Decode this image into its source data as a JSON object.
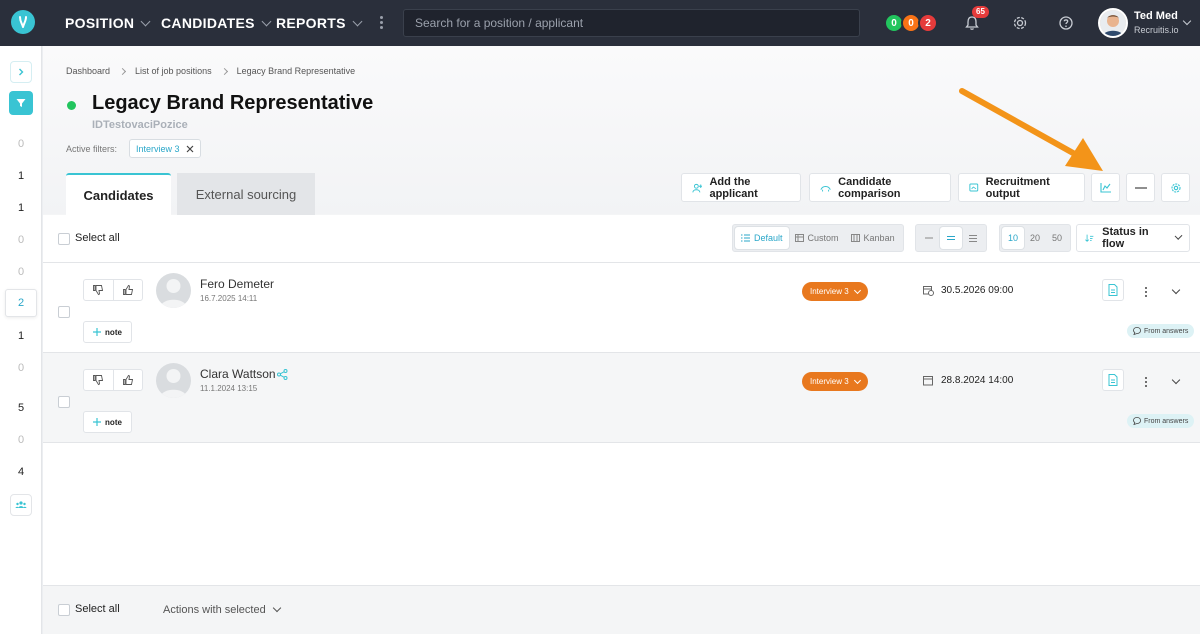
{
  "nav": {
    "items": [
      "POSITION",
      "CANDIDATES",
      "REPORTS"
    ],
    "search_placeholder": "Search for a position / applicant",
    "status_counts": [
      {
        "value": "0",
        "color": "#22c55e"
      },
      {
        "value": "0",
        "color": "#f97316"
      },
      {
        "value": "2",
        "color": "#e53b3b"
      }
    ],
    "notifications": "65",
    "user": {
      "name": "Ted Med",
      "company": "Recruitis.io"
    }
  },
  "sidebar": {
    "counts": [
      "0",
      "1",
      "1",
      "0",
      "0",
      "2",
      "1",
      "0",
      "5",
      "0",
      "4"
    ],
    "active_index": 5
  },
  "breadcrumb": [
    "Dashboard",
    "List of job positions",
    "Legacy Brand Representative"
  ],
  "position": {
    "title": "Legacy Brand Representative",
    "subtitle": "IDTestovaciPozice",
    "active_filters_label": "Active filters:",
    "filter_chip": "Interview 3"
  },
  "tabs": [
    "Candidates",
    "External sourcing"
  ],
  "actions": {
    "add_applicant": "Add the applicant",
    "compare": "Candidate comparison",
    "output": "Recruitment output"
  },
  "toolbar": {
    "select_all": "Select all",
    "views": [
      "Default",
      "Custom",
      "Kanban"
    ],
    "page_sizes": [
      "10",
      "20",
      "50"
    ],
    "sort_label": "Status in flow"
  },
  "candidates": [
    {
      "name": "Fero Demeter",
      "date": "16.7.2025 14:11",
      "stage": "Interview 3",
      "interview": "30.5.2026 09:00",
      "note": "note",
      "source": "From answers"
    },
    {
      "name": "Clara Wattson",
      "date": "11.1.2024 13:15",
      "stage": "Interview 3",
      "interview": "28.8.2024 14:00",
      "note": "note",
      "source": "From answers"
    }
  ],
  "footer": {
    "select_all": "Select all",
    "bulk_actions": "Actions with selected"
  },
  "colors": {
    "accent": "#39c4d3",
    "stage": "#e8781e",
    "arrow": "#f39419",
    "topbar": "#2a2f3b"
  }
}
